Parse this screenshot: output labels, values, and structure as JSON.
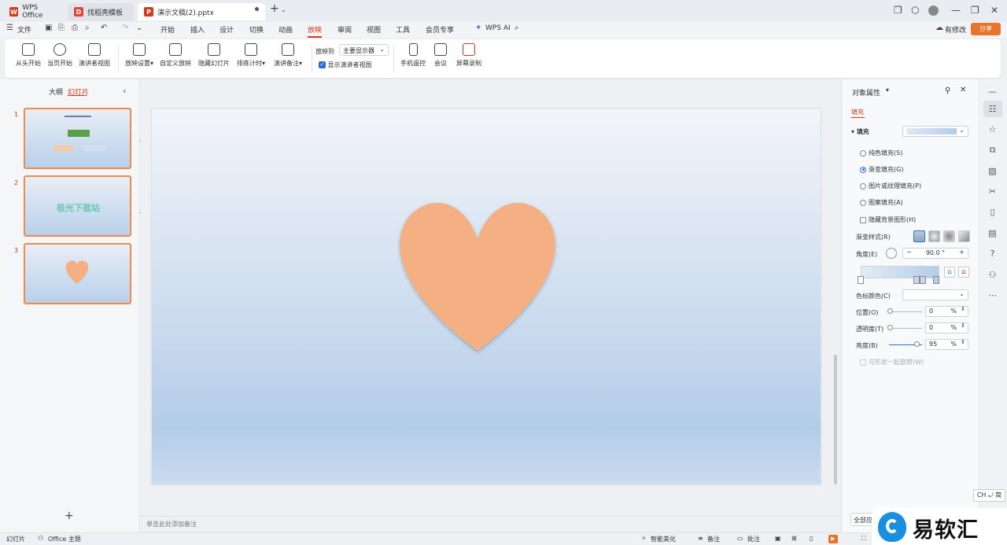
{
  "tabs": [
    {
      "label": "WPS Office"
    },
    {
      "label": "找稻壳模板"
    },
    {
      "label": "演示文稿(2).pptx"
    }
  ],
  "menu": {
    "file": "文件",
    "items": [
      "开始",
      "插入",
      "设计",
      "切换",
      "动画",
      "放映",
      "审阅",
      "视图",
      "工具",
      "会员专享"
    ],
    "wps_ai": "WPS AI",
    "changes": "有修改",
    "share": "分享"
  },
  "ribbon": {
    "from_start": "从头开始",
    "from_current": "当页开始",
    "presenter_view": "演讲者视图",
    "slideshow_settings": "放映设置",
    "custom_show": "自定义放映",
    "hide_slide": "隐藏幻灯片",
    "rehearse": "排练计时",
    "speaker_notes": "演讲备注",
    "show_on_label": "放映到",
    "show_on_value": "主要显示器",
    "show_presenter_label": "显示演讲者视图",
    "phone_remote": "手机遥控",
    "meeting": "会议",
    "screen_record": "屏幕录制"
  },
  "left_pane": {
    "tab_outline": "大纲",
    "tab_slides": "幻灯片",
    "slide_numbers": [
      "1",
      "2",
      "3"
    ],
    "thumb2_text": "极光下载站",
    "add": "+"
  },
  "notes_placeholder": "单击此处添加备注",
  "right_panel": {
    "title": "对象属性",
    "tab_fill": "填充",
    "fill_section": "填充",
    "options": [
      "纯色填充(S)",
      "渐变填充(G)",
      "图片或纹理填充(P)",
      "图案填充(A)"
    ],
    "selected_option": 1,
    "hide_bg_label": "隐藏背景图形(H)",
    "gradient_style_label": "渐变样式(R)",
    "angle_label": "角度(E)",
    "angle_value": "90.0 °",
    "stop_color_label": "色标颜色(C)",
    "position_label": "位置(O)",
    "position_value": "0",
    "transparency_label": "透明度(T)",
    "transparency_value": "0",
    "brightness_label": "亮度(B)",
    "brightness_value": "95",
    "percent": "%",
    "rotate_with_shape": "与形状一起旋转(W)",
    "apply_all": "全部应用"
  },
  "status": {
    "slide": "幻灯片",
    "theme": "Office 主题",
    "smart_beautify": "智能美化",
    "notes": "备注",
    "comments": "批注"
  },
  "ime": "CH ⤾ 简",
  "watermark": "易软汇",
  "colors": {
    "accent": "#d4381e",
    "heart": "#f4b083",
    "thumb_border": "#f08a4b",
    "share_btn": "#e8742c",
    "arrow": "#d9201c"
  }
}
